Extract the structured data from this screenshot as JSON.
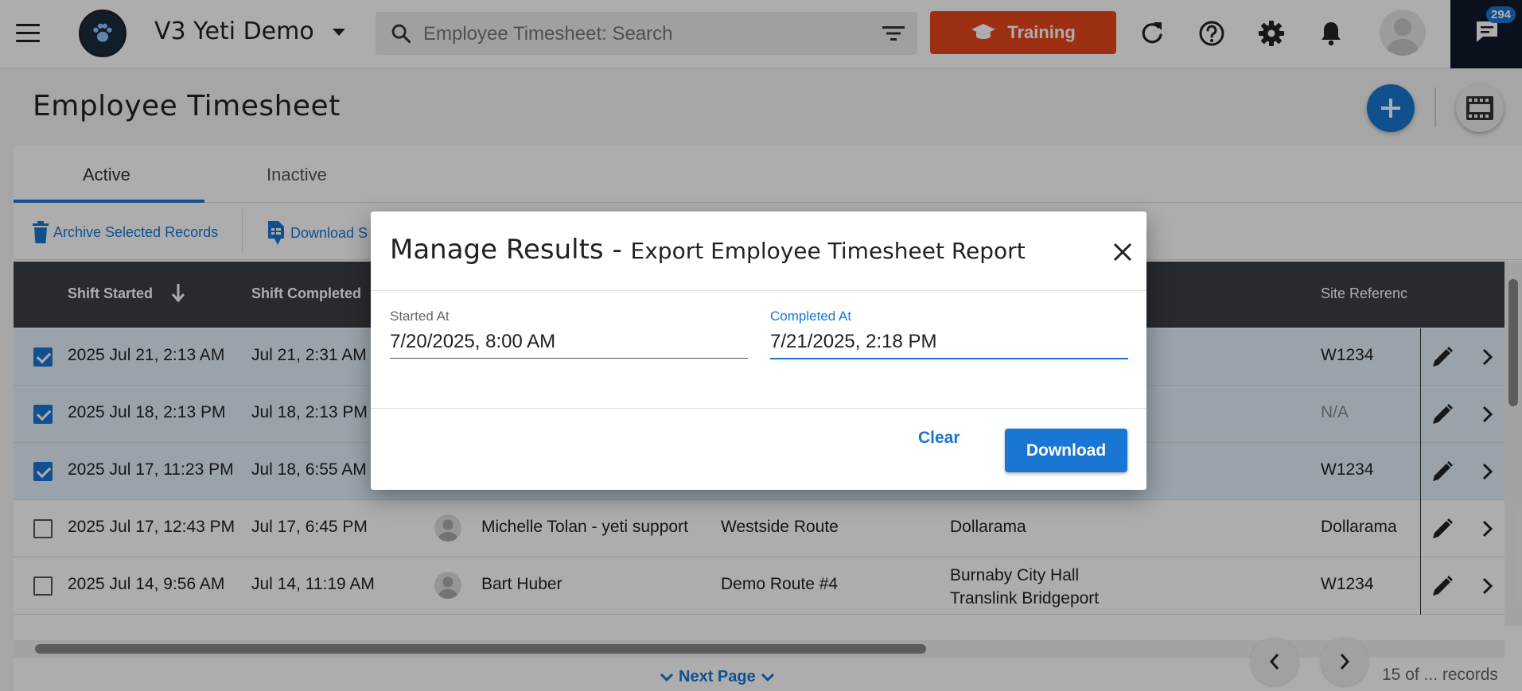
{
  "header": {
    "org_name": "V3 Yeti Demo",
    "search_placeholder": "Employee Timesheet: Search",
    "training_label": "Training",
    "chat_badge": "294"
  },
  "page": {
    "title": "Employee Timesheet"
  },
  "tabs": [
    {
      "label": "Active",
      "active": true
    },
    {
      "label": "Inactive",
      "active": false
    }
  ],
  "actions": {
    "archive_label": "Archive Selected Records",
    "download_label": "Download S"
  },
  "table": {
    "columns": {
      "shift_started": "Shift Started",
      "shift_completed": "Shift Completed",
      "site_reference": "Site Referenc"
    },
    "rows": [
      {
        "checked": true,
        "started": "2025 Jul 21, 2:13 AM",
        "completed": "Jul 21, 2:31 AM",
        "employee": "",
        "route": "",
        "site": "",
        "site2": "",
        "site_ref": "W1234"
      },
      {
        "checked": true,
        "started": "2025 Jul 18, 2:13 PM",
        "completed": "Jul 18, 2:13 PM",
        "employee": "",
        "route": "",
        "site": "",
        "site2": "",
        "site_ref": "N/A"
      },
      {
        "checked": true,
        "started": "2025 Jul 17, 11:23 PM",
        "completed": "Jul 18, 6:55 AM",
        "employee": "",
        "route": "",
        "site": "",
        "site2": "",
        "site_ref": "W1234"
      },
      {
        "checked": false,
        "started": "2025 Jul 17, 12:43 PM",
        "completed": "Jul 17, 6:45 PM",
        "employee": "Michelle Tolan - yeti support",
        "route": "Westside Route",
        "site": "Dollarama",
        "site2": "",
        "site_ref": "Dollarama"
      },
      {
        "checked": false,
        "started": "2025 Jul 14, 9:56 AM",
        "completed": "Jul 14, 11:19 AM",
        "employee": "Bart Huber",
        "route": "Demo Route #4",
        "site": "Burnaby City Hall",
        "site2": "Translink Bridgeport",
        "site_ref": "W1234"
      }
    ]
  },
  "pagination": {
    "next_page_label": "Next Page",
    "records_label": "15 of ... records"
  },
  "modal": {
    "title_main": "Manage Results",
    "title_sep": " - ",
    "title_sub": "Export Employee Timesheet Report",
    "started_label": "Started At",
    "started_value": "7/20/2025, 8:00 AM",
    "completed_label": "Completed At",
    "completed_value": "7/21/2025, 2:18 PM",
    "clear_label": "Clear",
    "download_label": "Download"
  },
  "colors": {
    "primary": "#1976d2",
    "training": "#e8471c",
    "table_header": "#3a3f45",
    "chat_bg": "#0f1a2b"
  },
  "icons": [
    "menu-icon",
    "paw-icon",
    "search-icon",
    "filter-icon",
    "graduation-cap-icon",
    "refresh-icon",
    "help-icon",
    "gear-icon",
    "bell-icon",
    "user-icon",
    "chat-icon",
    "plus-icon",
    "film-icon",
    "trash-icon",
    "file-download-icon",
    "arrow-down-icon",
    "pencil-icon",
    "chevron-right-icon",
    "chevron-left-icon",
    "chevron-down-icon",
    "close-icon"
  ]
}
